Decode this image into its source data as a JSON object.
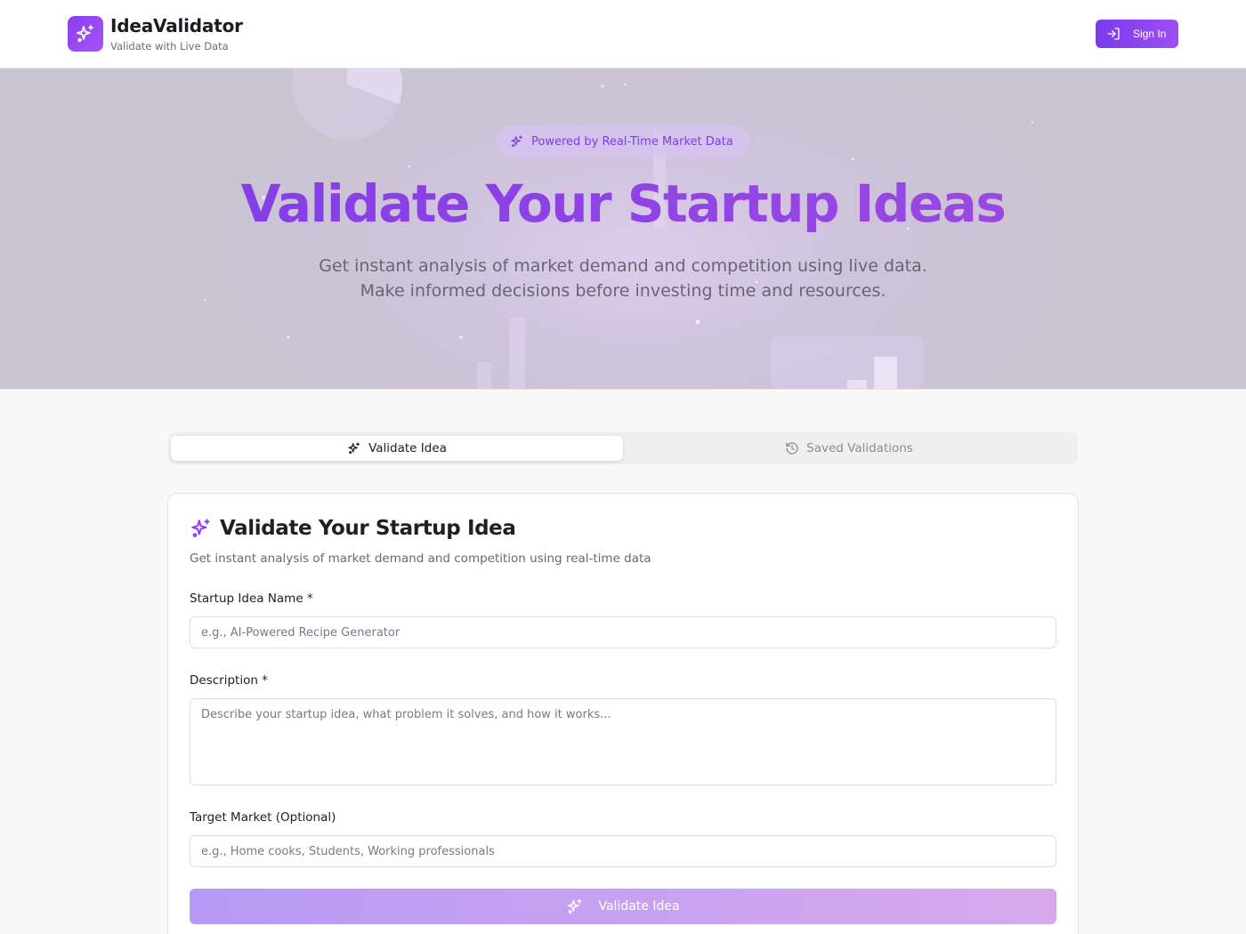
{
  "header": {
    "brand_name": "IdeaValidator",
    "brand_tagline": "Validate with Live Data",
    "signin_label": "Sign In",
    "logo_icon": "sparkles-icon",
    "signin_icon": "log-in-icon"
  },
  "hero": {
    "badge_text": "Powered by Real-Time Market Data",
    "title": "Validate Your Startup Ideas",
    "subtitle_line1": "Get instant analysis of market demand and competition using live data.",
    "subtitle_line2": "Make informed decisions before investing time and resources."
  },
  "tabs": [
    {
      "label": "Validate Idea",
      "icon": "sparkles-icon",
      "active": true
    },
    {
      "label": "Saved Validations",
      "icon": "history-icon",
      "active": false
    }
  ],
  "form": {
    "title": "Validate Your Startup Idea",
    "description": "Get instant analysis of market demand and competition using real-time data",
    "name_label": "Startup Idea Name *",
    "name_placeholder": "e.g., AI-Powered Recipe Generator",
    "name_value": "",
    "description_label": "Description *",
    "description_placeholder": "Describe your startup idea, what problem it solves, and how it works...",
    "description_value": "",
    "market_label": "Target Market (Optional)",
    "market_placeholder": "e.g., Home cooks, Students, Working professionals",
    "market_value": "",
    "submit_label": "Validate Idea"
  },
  "colors": {
    "accent": "#7c3aed",
    "accent_light": "#a855f7",
    "title_gradient_start": "#7e3bea",
    "title_gradient_end": "#a24be0"
  }
}
